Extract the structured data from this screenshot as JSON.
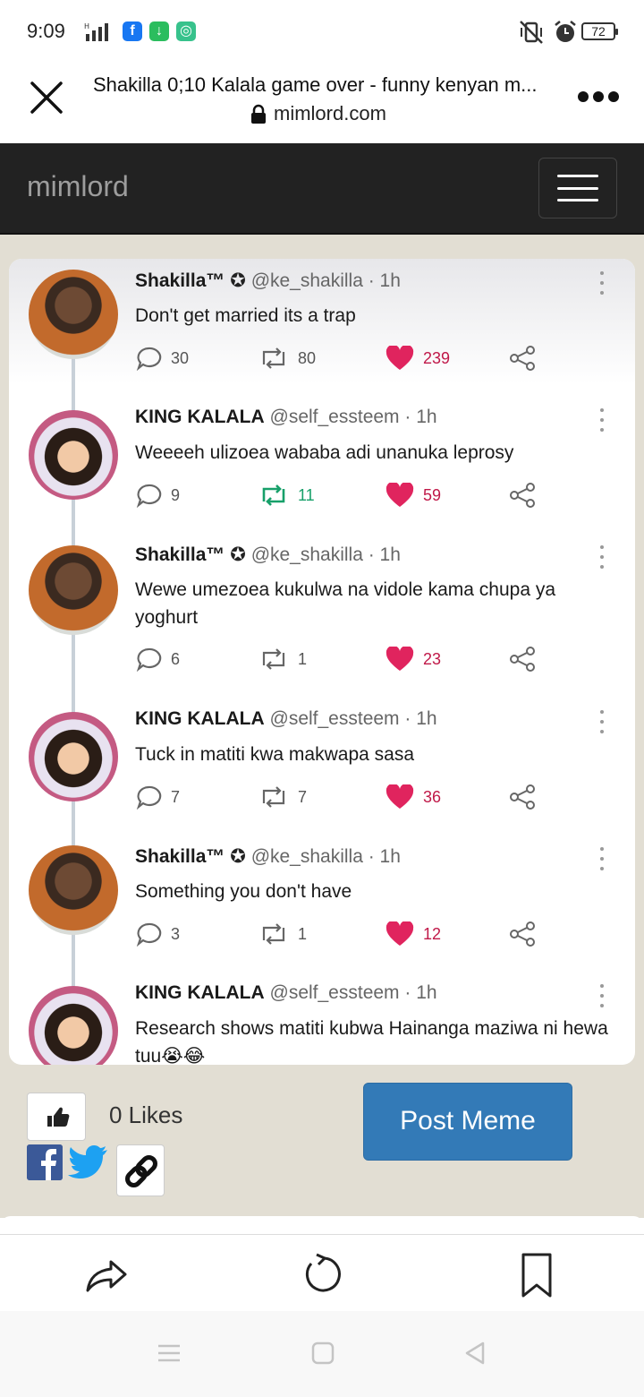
{
  "status_bar": {
    "time": "9:09",
    "battery": "72",
    "app_icons": [
      "facebook-icon",
      "download-icon",
      "g-app-icon"
    ]
  },
  "browser": {
    "page_title": "Shakilla 0;10 Kalala game over - funny kenyan m...",
    "url": "mimlord.com"
  },
  "site": {
    "brand": "mimlord"
  },
  "tweets": [
    {
      "name": "Shakilla™",
      "handle": "@ke_shakilla · 1h",
      "text": "Don't get married its a trap",
      "replies": "30",
      "retweets": "80",
      "likes": "239",
      "retweeted": false
    },
    {
      "name": "KING KALALA",
      "handle": "@self_essteem · 1h",
      "text": "Weeeeh ulizoea wababa adi unanuka leprosy",
      "replies": "9",
      "retweets": "11",
      "likes": "59",
      "retweeted": true
    },
    {
      "name": "Shakilla™",
      "handle": "@ke_shakilla · 1h",
      "text": "Wewe umezoea kukulwa na vidole kama chupa ya yoghurt",
      "replies": "6",
      "retweets": "1",
      "likes": "23",
      "retweeted": false
    },
    {
      "name": "KING KALALA",
      "handle": "@self_essteem · 1h",
      "text": "Tuck in matiti kwa makwapa sasa",
      "replies": "7",
      "retweets": "7",
      "likes": "36",
      "retweeted": false
    },
    {
      "name": "Shakilla™",
      "handle": "@ke_shakilla · 1h",
      "text": "Something you don't have",
      "replies": "3",
      "retweets": "1",
      "likes": "12",
      "retweeted": false
    },
    {
      "name": "KING KALALA",
      "handle": "@self_essteem · 1h",
      "text": "Research shows matiti kubwa Hainanga maziwa ni hewa tuu😭😂",
      "replies": "",
      "retweets": "",
      "likes": "",
      "retweeted": false
    }
  ],
  "actions": {
    "likes_text": "0 Likes",
    "post_button": "Post Meme"
  },
  "colors": {
    "navbar": "#222222",
    "brand_text": "#9d9d9d",
    "post_button": "#337ab7",
    "heart": "#e0245e",
    "retweet_active": "#17a06a",
    "page_background": "#e2ded3"
  }
}
